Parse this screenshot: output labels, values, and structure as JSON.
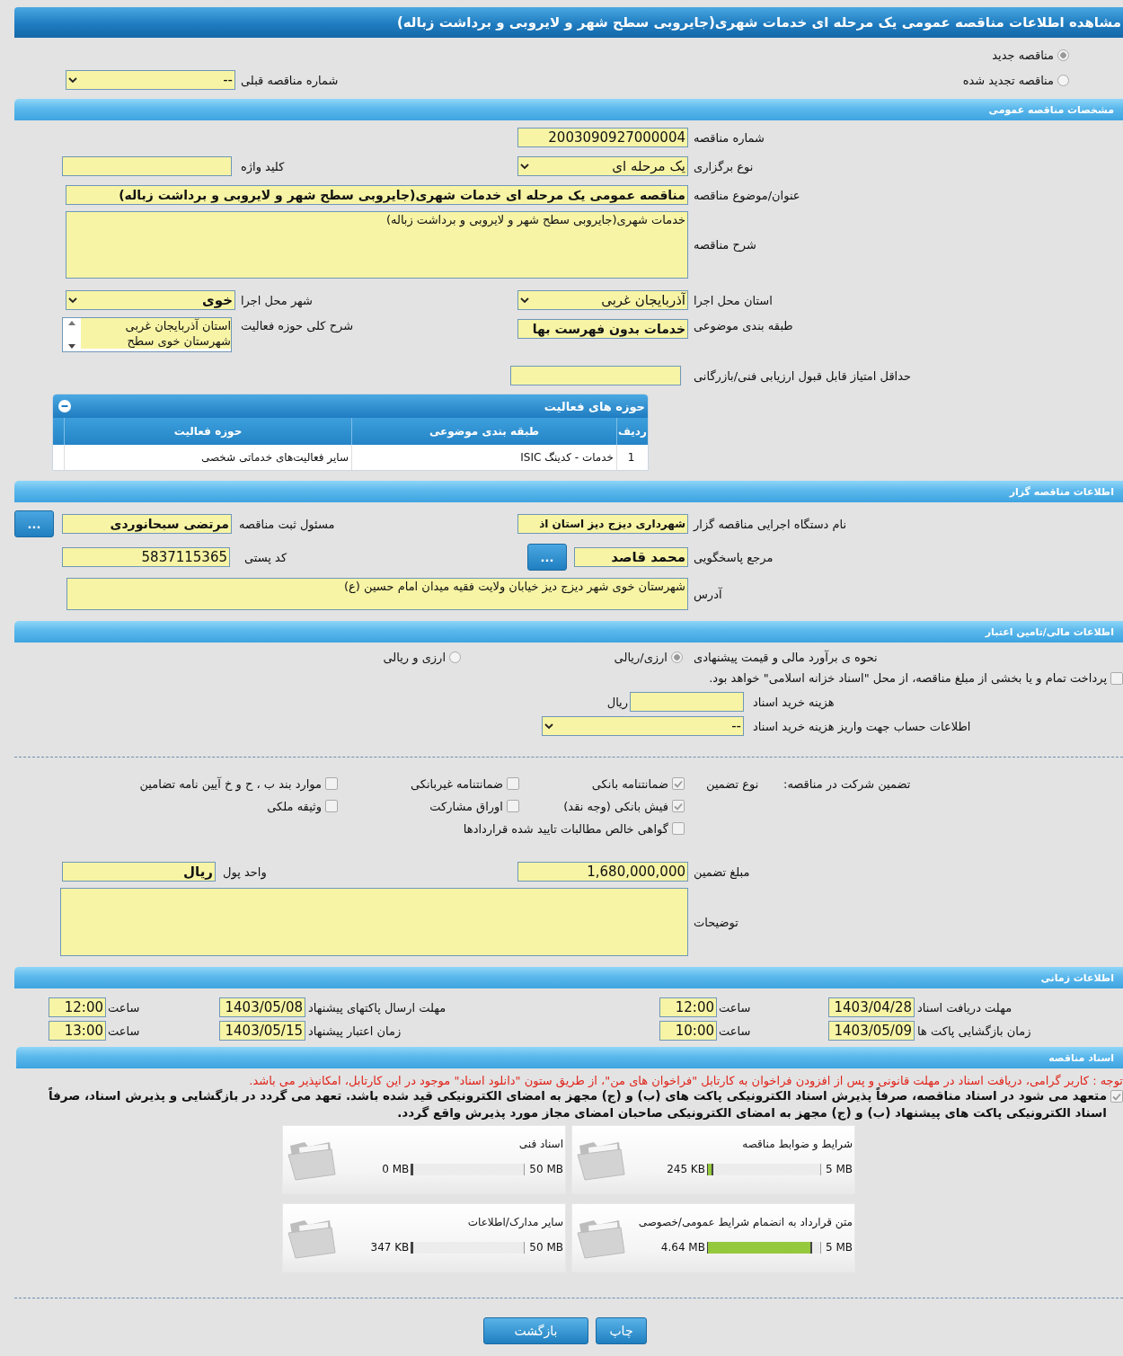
{
  "title": "مشاهده اطلاعات مناقصه عمومی یک مرحله ای خدمات شهری(جایروبی سطح شهر و لایروبی و برداشت زباله)",
  "tender_kind": [
    {
      "label": "مناقصه جدید",
      "selected": true
    },
    {
      "label": "مناقصه تجدید شده",
      "selected": false
    }
  ],
  "previous_tender": {
    "label": "شماره مناقصه قبلی",
    "value": "--"
  },
  "general": {
    "heading": "مشخصات مناقصه عمومی",
    "tender_number": {
      "label": "شماره مناقصه",
      "value": "2003090927000004"
    },
    "holding_type": {
      "label": "نوع برگزاری",
      "value": "یک مرحله ای"
    },
    "keyword": {
      "label": "کلید واژه"
    },
    "subject": {
      "label": "عنوان/موضوع مناقصه",
      "value": "مناقصه عمومی یک مرحله ای خدمات شهری(جایروبی سطح شهر و لایروبی و برداشت زباله)"
    },
    "description": {
      "label": "شرح مناقصه",
      "value": "خدمات شهری(جایروبی سطح شهر و لایروبی و برداشت زباله)"
    },
    "province": {
      "label": "استان محل اجرا",
      "value": "آذربایجان غربی"
    },
    "city": {
      "label": "شهر محل اجرا",
      "value": "خوی"
    },
    "category": {
      "label": "طبقه بندی موضوعی",
      "value": "خدمات بدون فهرست بها"
    },
    "activity_scope": {
      "label": "شرح کلی حوزه فعالیت",
      "options": [
        {
          "text": "استان آذربایجان غربی",
          "selected": true
        },
        {
          "text": "شهرستان خوی سطح",
          "selected": true
        }
      ]
    },
    "min_score": {
      "label": "حداقل امتیاز قابل قبول ارزیابی فنی/بازرگانی"
    },
    "activities": {
      "title": "حوزه های فعالیت",
      "expanded": true,
      "columns": [
        "ردیف",
        "طبقه بندی موضوعی",
        "حوزه فعالیت"
      ],
      "rows": [
        [
          "1",
          "خدمات - کدینگ ISIC",
          "سایر فعالیت‌های خدماتی شخصی"
        ]
      ]
    }
  },
  "organizer": {
    "heading": "اطلاعات مناقصه گزار",
    "agency": {
      "label": "نام دستگاه اجرایی مناقصه گزار",
      "value": "شهرداری دیزج دیز استان اذ"
    },
    "registrar": {
      "label": "مسئول ثبت مناقصه",
      "value": "مرتضی سبحانوردی",
      "button": "..."
    },
    "contact": {
      "label": "مرجع پاسخگویی",
      "value": "محمد قاصد",
      "button": "..."
    },
    "postal_code": {
      "label": "کد پستی",
      "value": "5837115365"
    },
    "address": {
      "label": "آدرس",
      "value": "شهرستان خوی شهر دیزج دیز خیابان ولایت فقیه میدان امام حسین (ع)"
    }
  },
  "finance": {
    "heading": "اطلاعات مالی/تامین اعتبار",
    "estimate": {
      "label": "نحوه ی برآورد مالی و قیمت پیشنهادی",
      "options": [
        {
          "label": "ارزی/ریالی",
          "selected": true
        },
        {
          "label": "ارزی و ریالی",
          "selected": false
        }
      ]
    },
    "treasury_payment": {
      "label": "پرداخت تمام و یا بخشی از مبلغ مناقصه، از محل \"اسناد خزانه اسلامی\" خواهد بود.",
      "checked": false
    },
    "document_fee": {
      "label": "هزینه خرید اسناد",
      "unit": "ریال"
    },
    "fee_account": {
      "label": "اطلاعات حساب جهت واریز هزینه خرید اسناد",
      "value": "--"
    }
  },
  "guarantee": {
    "heading": "تضمین شرکت در مناقصه:",
    "type_label": "نوع تضمین",
    "options": [
      {
        "label": "ضمانتنامه بانکی",
        "checked": true
      },
      {
        "label": "ضمانتنامه غیربانکی",
        "checked": false
      },
      {
        "label": "موارد بند ب ، ح و خ آیین نامه تضامین",
        "checked": false
      },
      {
        "label": "فیش بانکی (وجه نقد)",
        "checked": true
      },
      {
        "label": "اوراق مشارکت",
        "checked": false
      },
      {
        "label": "وثیقه ملکی",
        "checked": false
      },
      {
        "label": "گواهی خالص مطالبات تایید شده قراردادها",
        "checked": false
      }
    ],
    "amount": {
      "label": "مبلغ تضمین",
      "value": "1,680,000,000"
    },
    "currency": {
      "label": "واحد پول",
      "value": "ریال"
    },
    "notes": {
      "label": "توضیحات"
    }
  },
  "schedule": {
    "heading": "اطلاعات زمانی",
    "rows": [
      [
        {
          "label": "مهلت دریافت اسناد",
          "date": "1403/04/28",
          "time_label": "ساعت",
          "time": "12:00"
        },
        {
          "label": "مهلت ارسال پاکتهای پیشنهاد",
          "date": "1403/05/08",
          "time_label": "ساعت",
          "time": "12:00"
        }
      ],
      [
        {
          "label": "زمان بازگشایی پاکت ها",
          "date": "1403/05/09",
          "time_label": "ساعت",
          "time": "10:00"
        },
        {
          "label": "زمان اعتبار پیشنهاد",
          "date": "1403/05/15",
          "time_label": "ساعت",
          "time": "13:00"
        }
      ]
    ]
  },
  "documents": {
    "heading": "اسناد مناقصه",
    "notice": "توجه : کاربر گرامی، دریافت اسناد در مهلت قانونی و پس از افزودن فراخوان به کارتابل \"فراخوان های من\"، از طریق ستون \"دانلود اسناد\" موجود در این کارتابل، امکانپذیر می باشد.",
    "commitment": {
      "text": "متعهد می شود در اسناد مناقصه، صرفاً پذیرش اسناد الکترونیکی پاکت های (ب) و (ج) مجهز به امضای الکترونیکی قید شده باشد. تعهد می گردد در بازگشایی و پذیرش اسناد، صرفاً اسناد الکترونیکی پاکت های پیشنهاد (ب) و (ج) مجهز به امضای الکترونیکی صاحبان امضای مجاز مورد پذیرش واقع گردد.",
      "checked": true
    },
    "files": [
      {
        "title": "شرایط و ضوابط مناقصه",
        "used": "245 KB",
        "max": "5 MB",
        "level": 0.048
      },
      {
        "title": "اسناد فنی",
        "used": "0 MB",
        "max": "50 MB",
        "level": 0
      },
      {
        "title": "متن قرارداد به انضمام شرایط عمومی/خصوصی",
        "used": "4.64 MB",
        "max": "5 MB",
        "level": 0.928
      },
      {
        "title": "سایر مدارک/اطلاعات",
        "used": "347 KB",
        "max": "50 MB",
        "level": 0.007
      }
    ]
  },
  "buttons": [
    {
      "label": "چاپ"
    },
    {
      "label": "بازگشت"
    }
  ]
}
